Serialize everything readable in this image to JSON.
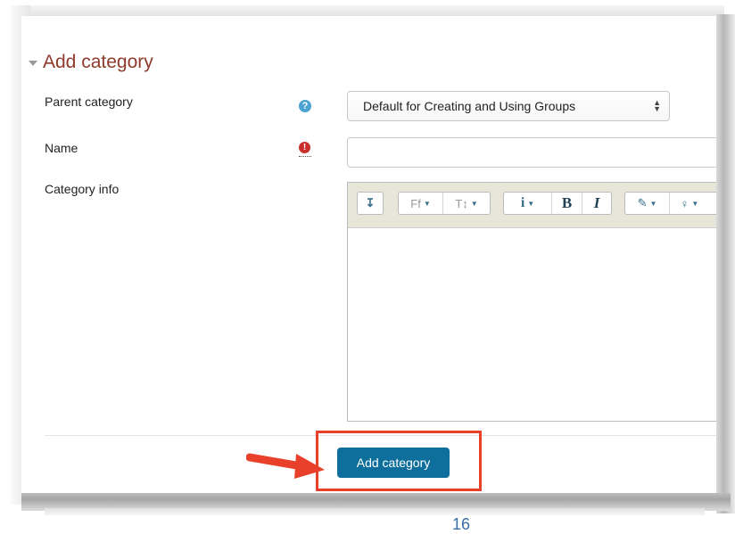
{
  "section": {
    "title": "Add category"
  },
  "fields": {
    "parent_label": "Parent category",
    "parent_value": "Default for Creating and Using Groups",
    "name_label": "Name",
    "name_value": "",
    "info_label": "Category info"
  },
  "editor": {
    "toolbar": [
      {
        "icon": "toggle-toolbar-icon",
        "glyph": "↧"
      },
      {
        "icon": "font-family-icon",
        "glyph": "Ff"
      },
      {
        "icon": "font-size-icon",
        "glyph": "T↕"
      },
      {
        "icon": "info-icon",
        "glyph": "i"
      },
      {
        "icon": "bold-icon",
        "glyph": "B"
      },
      {
        "icon": "italic-icon",
        "glyph": "I"
      },
      {
        "icon": "brush-icon",
        "glyph": "✎"
      },
      {
        "icon": "lightbulb-icon",
        "glyph": "♀"
      }
    ]
  },
  "actions": {
    "submit_label": "Add category"
  },
  "page": {
    "number": "16"
  },
  "colors": {
    "legend": "#8f3a2b",
    "button": "#0f6f9c",
    "highlight": "#e8402a",
    "arrow": "#e8402a"
  }
}
